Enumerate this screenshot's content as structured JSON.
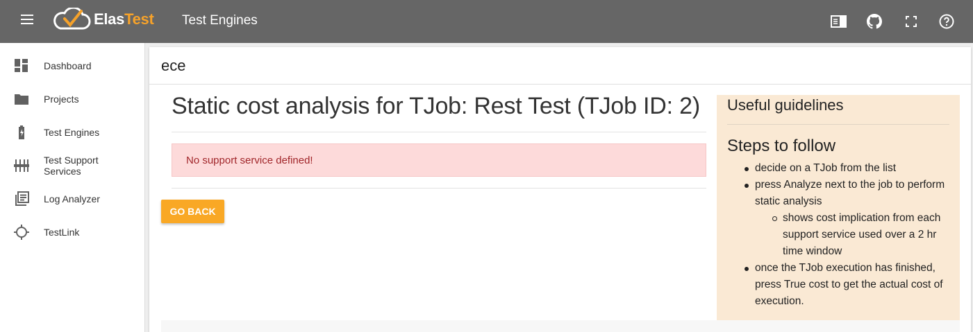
{
  "topbar": {
    "brand_part1": "Elas",
    "brand_part2": "Test",
    "page_title": "Test Engines",
    "icons": [
      "menu-icon",
      "sidebar-panel-icon",
      "github-icon",
      "fullscreen-icon",
      "help-icon"
    ]
  },
  "sidebar": {
    "items": [
      {
        "label": "Dashboard",
        "icon": "dashboard-icon"
      },
      {
        "label": "Projects",
        "icon": "folder-icon"
      },
      {
        "label": "Test Engines",
        "icon": "battery-charging-icon"
      },
      {
        "label": "Test Support Services",
        "icon": "sliders-icon"
      },
      {
        "label": "Log Analyzer",
        "icon": "library-books-icon"
      },
      {
        "label": "TestLink",
        "icon": "crosshair-icon"
      }
    ]
  },
  "card": {
    "title": "ece"
  },
  "main": {
    "heading": "Static cost analysis for TJob: Rest Test (TJob ID: 2)",
    "alert": "No support service defined!",
    "go_back_label": "GO BACK"
  },
  "guide": {
    "title": "Useful guidelines",
    "steps_title": "Steps to follow",
    "steps": [
      "decide on a TJob from the list",
      "press Analyze next to the job to perform static analysis",
      "once the TJob execution has finished, press True cost to get the actual cost of execution."
    ],
    "substeps": [
      "shows cost implication from each support service used over a 2 hr time window"
    ]
  },
  "colors": {
    "topbar_bg": "#666666",
    "accent": "#f9a825",
    "alert_bg": "#fddada",
    "alert_text": "#a1262a",
    "guide_bg": "#fae9d4"
  }
}
